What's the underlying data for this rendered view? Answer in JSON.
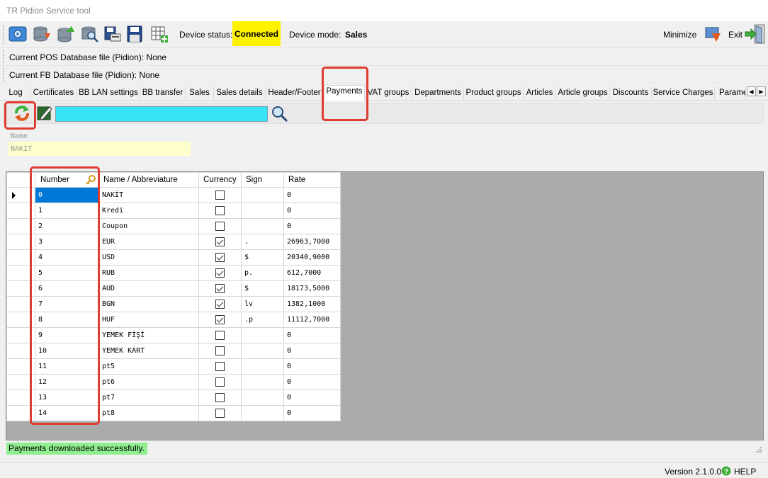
{
  "window": {
    "title": "TR Pidion Service tool"
  },
  "toolbar": {
    "buttons": [
      {
        "name": "settings-icon"
      },
      {
        "name": "database-download-icon"
      },
      {
        "name": "database-upload-icon"
      },
      {
        "name": "search-database-icon"
      },
      {
        "name": "print-icon"
      },
      {
        "name": "save-icon"
      },
      {
        "name": "add-grid-icon"
      }
    ],
    "device_status_label": "Device status:",
    "device_status_value": "Connected",
    "device_status_color": "#fff200",
    "device_mode_label": "Device mode:",
    "device_mode_value": "Sales",
    "minimize_label": "Minimize",
    "exit_label": "Exit"
  },
  "info": {
    "pos_db": "Current POS Database file (Pidion): None",
    "fb_db": "Current FB Database file (Pidion): None"
  },
  "tabs": [
    "Log",
    "Certificates",
    "BB LAN settings",
    "BB transfer",
    "Sales",
    "Sales details",
    "Header/Footer",
    "Payments",
    "VAT groups",
    "Departments",
    "Product groups",
    "Articles",
    "Article groups",
    "Discounts",
    "Service Charges",
    "Parame"
  ],
  "active_tab": "Payments",
  "form": {
    "name_label": "Name",
    "name_value": "NAKİT"
  },
  "table": {
    "columns": [
      "Number",
      "Name / Abbreviature",
      "Currency",
      "Sign",
      "Rate"
    ],
    "rows": [
      {
        "number": "0",
        "name": "NAKİT",
        "currency": false,
        "sign": "",
        "rate": "0"
      },
      {
        "number": "1",
        "name": "Kredi",
        "currency": false,
        "sign": "",
        "rate": "0"
      },
      {
        "number": "2",
        "name": "Coupon",
        "currency": false,
        "sign": "",
        "rate": "0"
      },
      {
        "number": "3",
        "name": "EUR",
        "currency": true,
        "sign": ".",
        "rate": "26963,7000"
      },
      {
        "number": "4",
        "name": "USD",
        "currency": true,
        "sign": "$",
        "rate": "20340,9000"
      },
      {
        "number": "5",
        "name": "RUB",
        "currency": true,
        "sign": "p.",
        "rate": "612,7000"
      },
      {
        "number": "6",
        "name": "AUD",
        "currency": true,
        "sign": "$",
        "rate": "18173,5000"
      },
      {
        "number": "7",
        "name": "BGN",
        "currency": true,
        "sign": "lv",
        "rate": "1382,1000"
      },
      {
        "number": "8",
        "name": "HUF",
        "currency": true,
        "sign": ".p",
        "rate": "11112,7000"
      },
      {
        "number": "9",
        "name": "YEMEK FİŞİ",
        "currency": false,
        "sign": "",
        "rate": "0"
      },
      {
        "number": "10",
        "name": "YEMEK KART",
        "currency": false,
        "sign": "",
        "rate": "0"
      },
      {
        "number": "11",
        "name": "pt5",
        "currency": false,
        "sign": "",
        "rate": "0"
      },
      {
        "number": "12",
        "name": "pt6",
        "currency": false,
        "sign": "",
        "rate": "0"
      },
      {
        "number": "13",
        "name": "pt7",
        "currency": false,
        "sign": "",
        "rate": "0"
      },
      {
        "number": "14",
        "name": "pt8",
        "currency": false,
        "sign": "",
        "rate": "0"
      }
    ]
  },
  "status": {
    "message": "Payments downloaded successfully.",
    "message_color": "#90ee90"
  },
  "footer": {
    "version": "Version 2.1.0.0",
    "help": "HELP"
  },
  "accent": {
    "highlight_box": "#e03c31",
    "selection": "#0078d7",
    "search_box": "#39e3f7"
  }
}
